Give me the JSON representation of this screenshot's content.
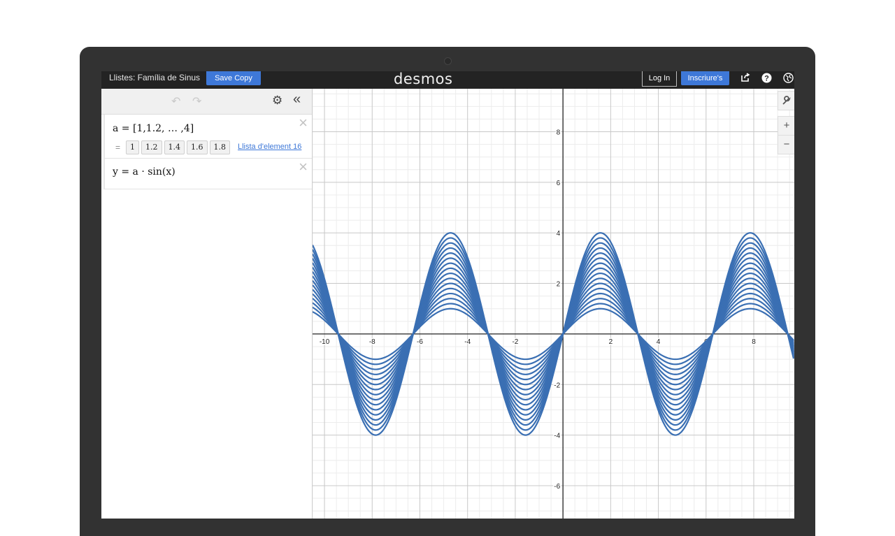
{
  "header": {
    "doc_title": "Llistes: Família de Sinus",
    "save_copy": "Save Copy",
    "logo": "desmos",
    "login": "Log In",
    "signup": "Inscriure's"
  },
  "panel": {
    "expr1": {
      "math": "a = [1,1.2, … ,4]",
      "eq": "=",
      "chips": [
        "1",
        "1.2",
        "1.4",
        "1.6",
        "1.8"
      ],
      "link": "Llista d'element 16"
    },
    "expr2": {
      "math": "y = a · sin(x)"
    }
  },
  "graph": {
    "x_ticks": [
      "-10",
      "-8",
      "-6",
      "-4",
      "-2",
      "2",
      "4",
      "6",
      "8"
    ],
    "y_ticks": [
      "8",
      "6",
      "4",
      "2",
      "-2",
      "-4",
      "-6"
    ],
    "curve_color": "#3a6fb3"
  },
  "chart_data": {
    "type": "line",
    "expression": "y = a · sin(x)",
    "a_values": [
      1,
      1.2,
      1.4,
      1.6,
      1.8,
      2,
      2.2,
      2.4,
      2.6,
      2.8,
      3,
      3.2,
      3.4,
      3.6,
      3.8,
      4
    ],
    "xlim": [
      -10.5,
      9.7
    ],
    "ylim": [
      -7.3,
      9.7
    ],
    "grid": true,
    "color": "#3a6fb3"
  }
}
